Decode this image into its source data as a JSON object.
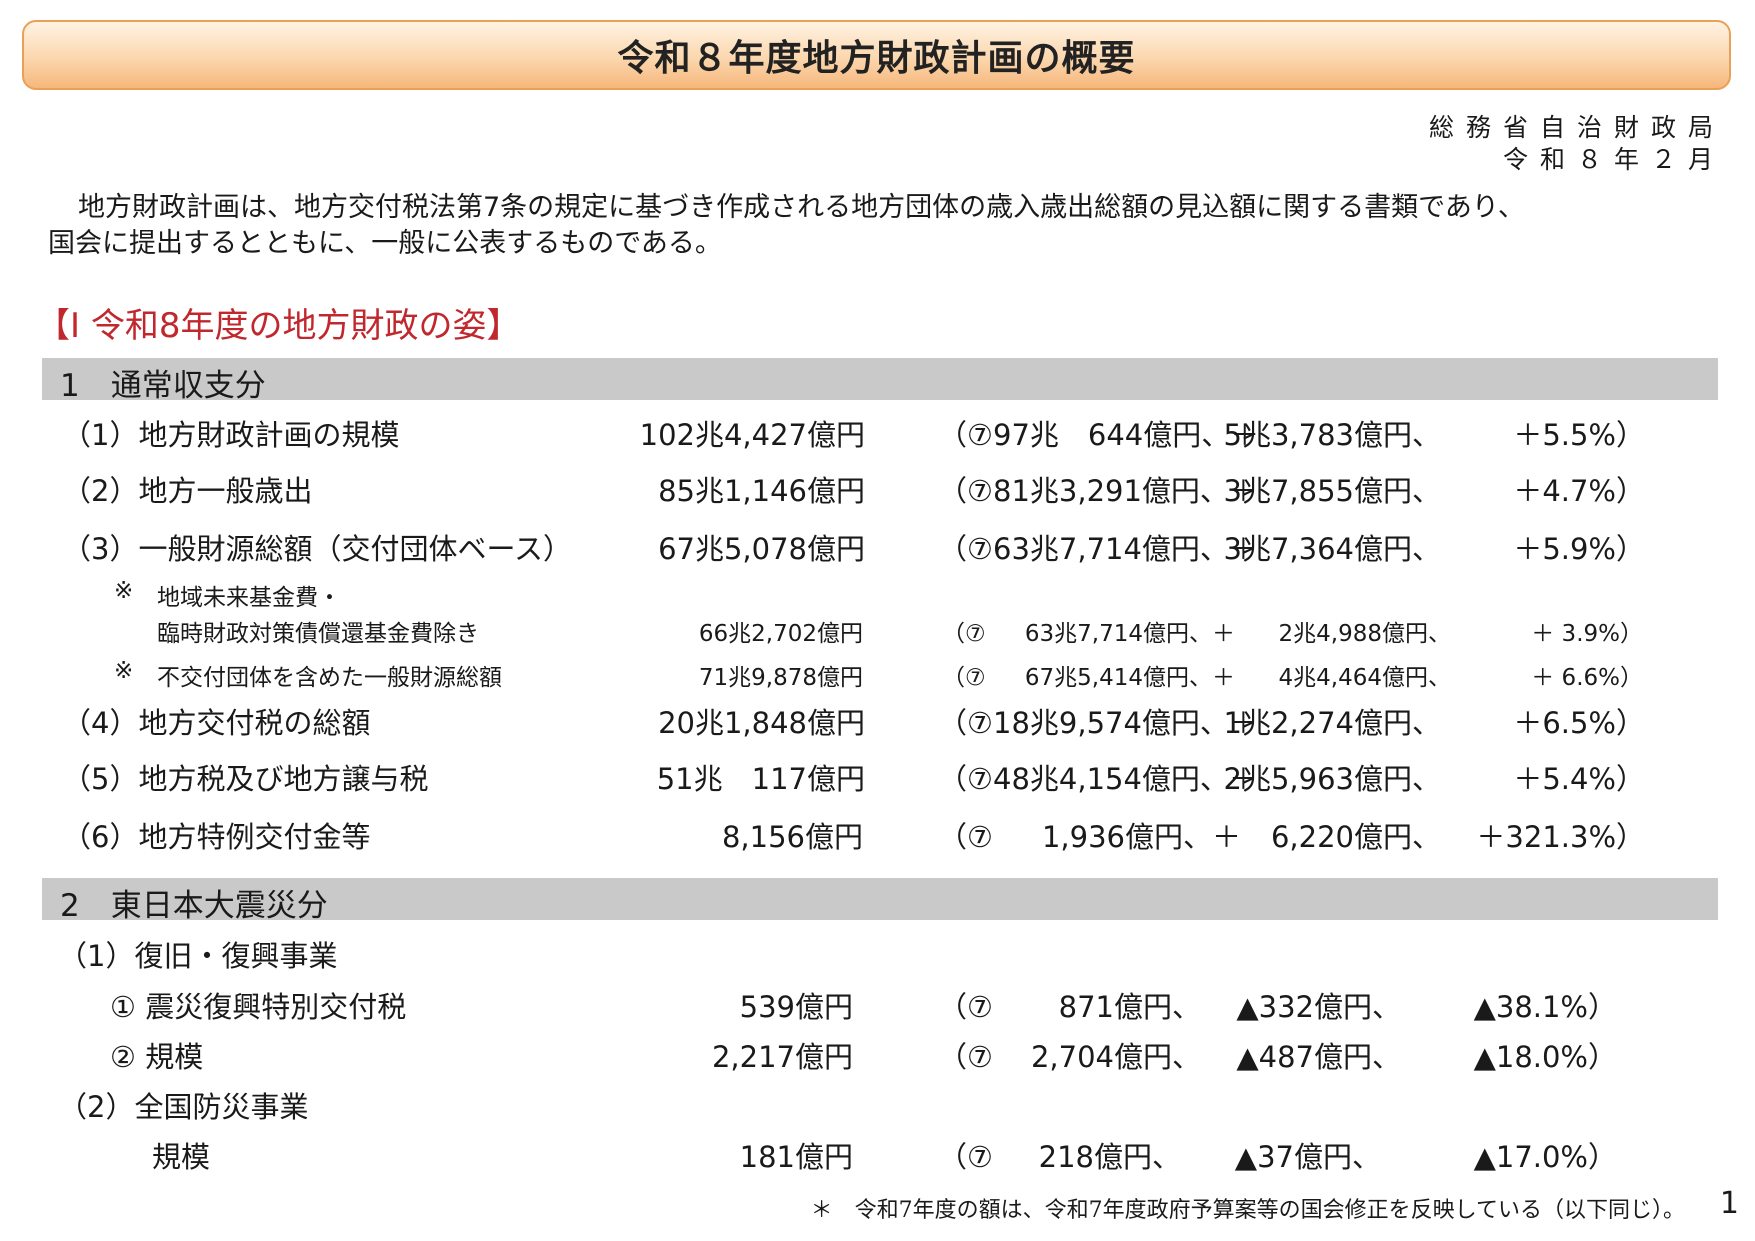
{
  "title": "令和８年度地方財政計画の概要",
  "issuer": {
    "org": "総務省自治財政局",
    "date": "令和８年２月"
  },
  "intro": {
    "line1": "地方財政計画は、地方交付税法第7条の規定に基づき作成される地方団体の歳入歳出総額の見込額に関する書類であり、",
    "line2": "国会に提出するとともに、一般に公表するものである。"
  },
  "section_heading": "【Ⅰ 令和8年度の地方財政の姿】",
  "part1": {
    "heading": "1　通常収支分",
    "rows": [
      {
        "label": "（1）地方財政計画の規模",
        "amount": "102兆4,427億円",
        "prev_open": "（⑦97兆　644億円、＋",
        "diff": "5兆3,783億円、",
        "rate": "＋5.5%）"
      },
      {
        "label": "（2）地方一般歳出",
        "amount": "85兆1,146億円",
        "prev_open": "（⑦81兆3,291億円、＋",
        "diff": "3兆7,855億円、",
        "rate": "＋4.7%）"
      },
      {
        "label": "（3）一般財源総額（交付団体ベース）",
        "amount": "67兆5,078億円",
        "prev_open": "（⑦63兆7,714億円、＋",
        "diff": "3兆7,364億円、",
        "rate": "＋5.9%）"
      },
      {
        "label": "（4）地方交付税の総額",
        "amount": "20兆1,848億円",
        "prev_open": "（⑦18兆9,574億円、＋",
        "diff": "1兆2,274億円、",
        "rate": "＋6.5%）"
      },
      {
        "label": "（5）地方税及び地方譲与税",
        "amount": "51兆　117億円",
        "prev_open": "（⑦48兆4,154億円、＋",
        "diff": "2兆5,963億円、",
        "rate": "＋5.4%）"
      },
      {
        "label": "（6）地方特例交付金等",
        "amount": "8,156億円",
        "prev_open": "（⑦",
        "prev": "1,936億円、＋",
        "diff": "6,220億円、",
        "rate": "＋321.3%）"
      }
    ],
    "notes": [
      {
        "mark": "※",
        "label1": "地域未来基金費・",
        "label2": "臨時財政対策債償還基金費除き",
        "amount": "66兆2,702億円",
        "prev_open": "（⑦",
        "prev": "63兆7,714億円、＋",
        "diff": "2兆4,988億円、",
        "rate": "＋ 3.9%）"
      },
      {
        "mark": "※",
        "label1": "不交付団体を含めた一般財源総額",
        "amount": "71兆9,878億円",
        "prev_open": "（⑦",
        "prev": "67兆5,414億円、＋",
        "diff": "4兆4,464億円、",
        "rate": "＋ 6.6%）"
      }
    ]
  },
  "part2": {
    "heading": "2　東日本大震災分",
    "sub1": "（1）復旧・復興事業",
    "rows1": [
      {
        "label": "① 震災復興特別交付税",
        "amount": "539億円",
        "prev_open": "（⑦",
        "prev": "871億円、",
        "diff": "▲332億円、",
        "rate": "▲38.1%）"
      },
      {
        "label": "② 規模",
        "amount": "2,217億円",
        "prev_open": "（⑦",
        "prev": "2,704億円、",
        "diff": "▲487億円、",
        "rate": "▲18.0%）"
      }
    ],
    "sub2": "（2）全国防災事業",
    "rows2": [
      {
        "label": "規模",
        "amount": "181億円",
        "prev_open": "（⑦",
        "prev": "218億円、",
        "diff": "▲37億円、",
        "rate": "▲17.0%）"
      }
    ]
  },
  "footnote": "＊　令和7年度の額は、令和7年度政府予算案等の国会修正を反映している（以下同じ）。",
  "page_number": "1"
}
